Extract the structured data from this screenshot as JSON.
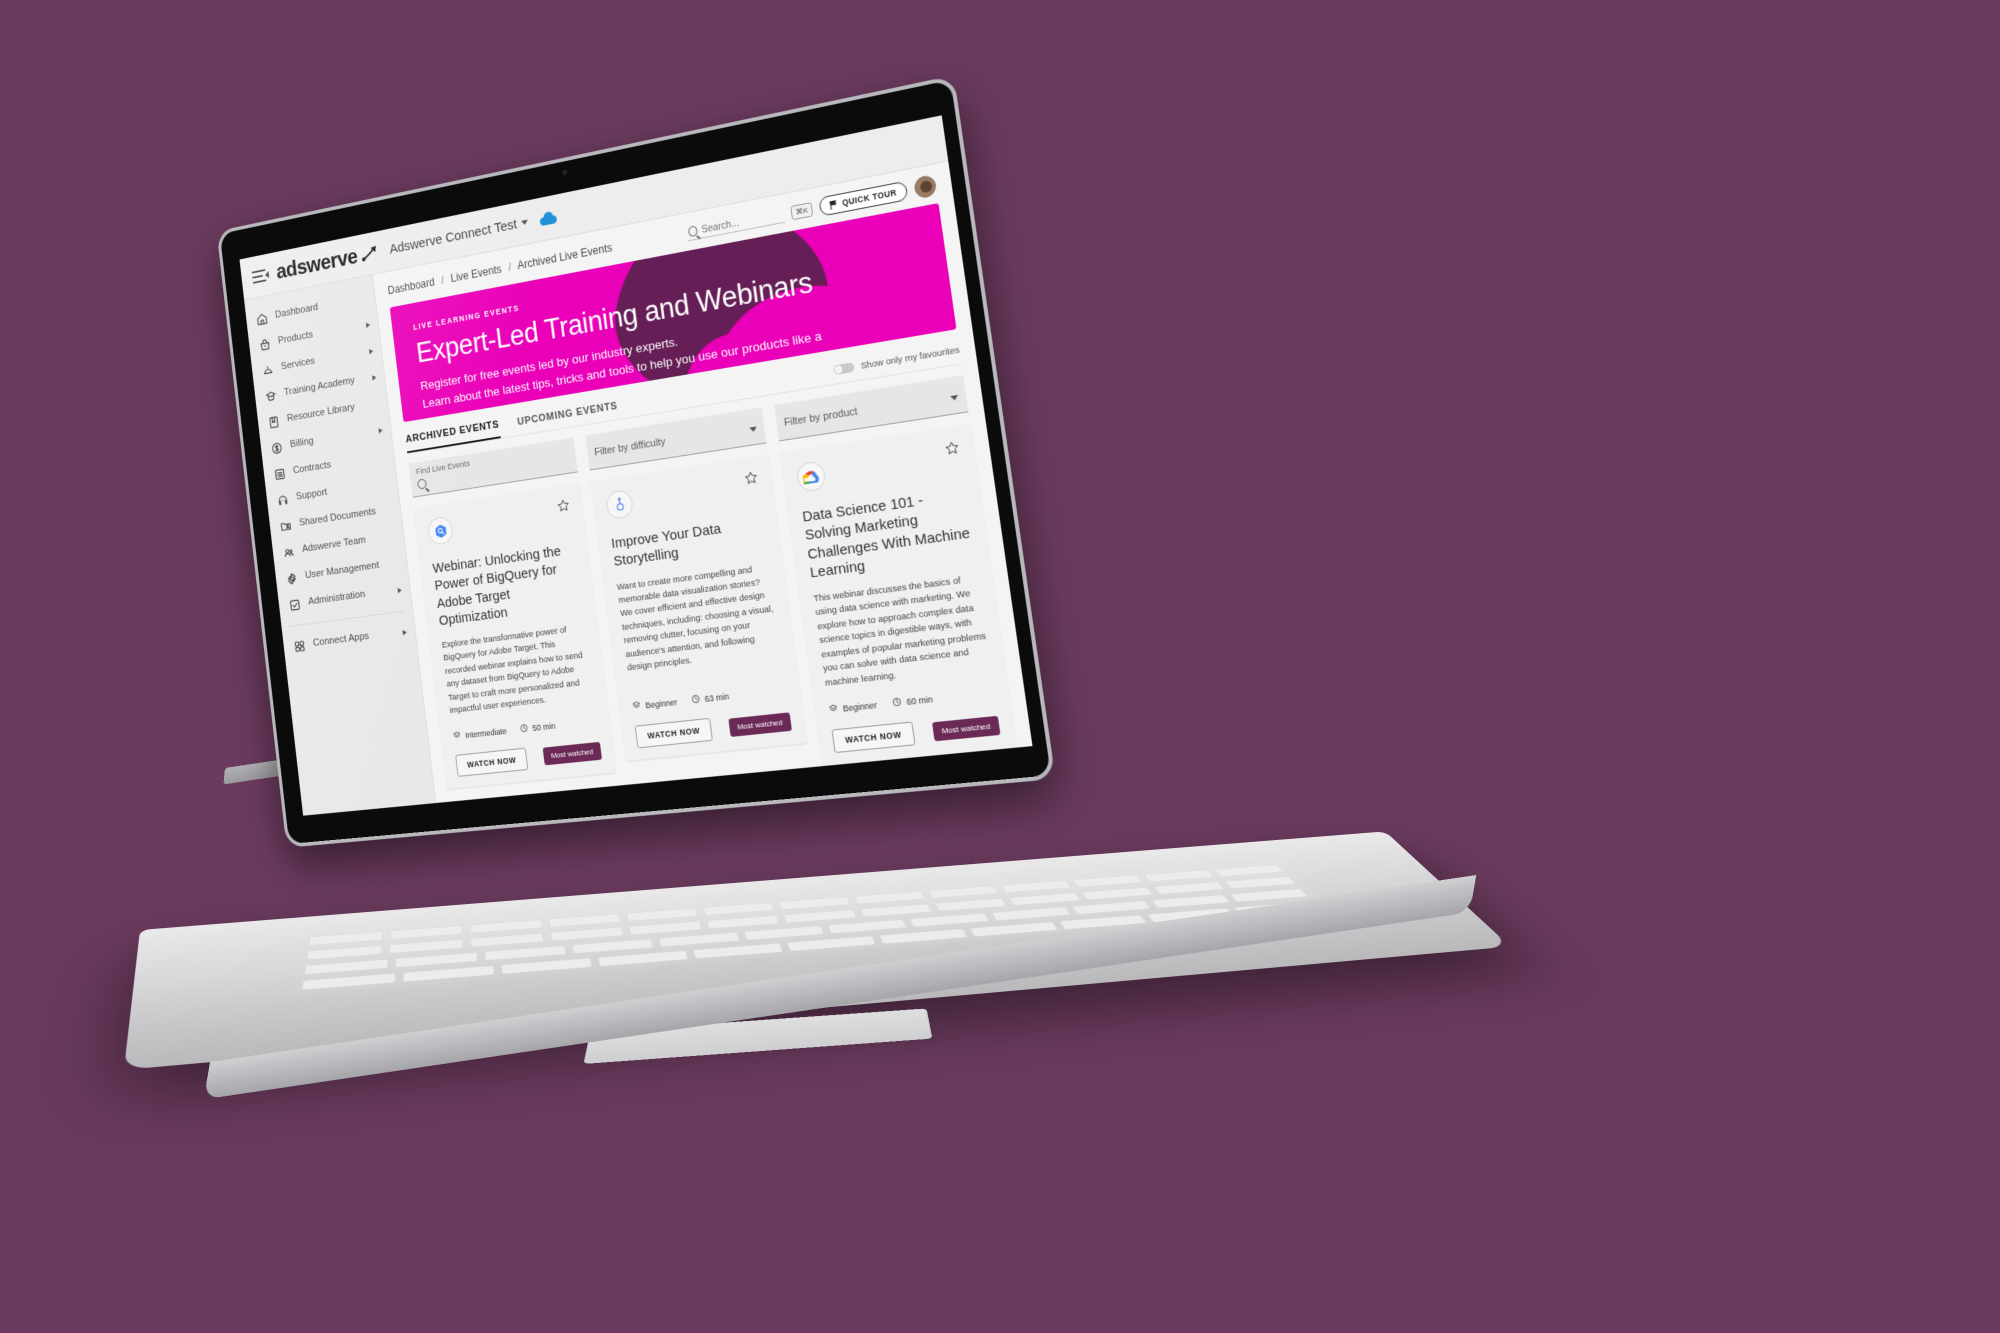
{
  "topbar": {
    "menu_icon": "hamburger-collapse-icon",
    "brand": "adswerve",
    "brand_mark_icon": "adswerve-swoosh-icon",
    "account": "Adswerve Connect Test",
    "account_caret_icon": "chevron-down-icon",
    "cloud_icon": "cloud-icon"
  },
  "sidebar": {
    "items": [
      {
        "label": "Dashboard",
        "icon": "home-icon",
        "expandable": false
      },
      {
        "label": "Products",
        "icon": "basket-icon",
        "expandable": true
      },
      {
        "label": "Services",
        "icon": "service-bell-icon",
        "expandable": true
      },
      {
        "label": "Training Academy",
        "icon": "graduation-cap-icon",
        "expandable": true
      },
      {
        "label": "Resource Library",
        "icon": "book-icon",
        "expandable": false
      },
      {
        "label": "Billing",
        "icon": "dollar-coin-icon",
        "expandable": true
      },
      {
        "label": "Contracts",
        "icon": "list-document-icon",
        "expandable": false
      },
      {
        "label": "Support",
        "icon": "headset-icon",
        "expandable": false
      },
      {
        "label": "Shared Documents",
        "icon": "shared-folder-icon",
        "expandable": false
      },
      {
        "label": "Adswerve Team",
        "icon": "people-icon",
        "expandable": false
      },
      {
        "label": "User Management",
        "icon": "gear-icon",
        "expandable": false
      },
      {
        "label": "Administration",
        "icon": "admin-check-icon",
        "expandable": true
      }
    ],
    "footer_items": [
      {
        "label": "Connect Apps",
        "icon": "grid-apps-icon",
        "expandable": true
      }
    ]
  },
  "breadcrumb": {
    "items": [
      "Dashboard",
      "Live Events",
      "Archived Live Events"
    ],
    "separator": "/"
  },
  "toolbar": {
    "search_placeholder": "Search...",
    "search_value": "",
    "search_icon": "search-icon",
    "shortcut_key": "⌘K",
    "quick_tour_label": "QUICK TOUR",
    "quick_tour_icon": "flag-icon",
    "avatar_name": "user-avatar"
  },
  "hero": {
    "eyebrow": "LIVE LEARNING EVENTS",
    "title": "Expert-Led Training and Webinars",
    "line1": "Register for free events led by our industry experts.",
    "line2": "Learn about the latest tips, tricks and tools to help you use our products like a pro.",
    "bg_color": "#ea00b8",
    "blob_color": "#5e2150"
  },
  "tabs": [
    {
      "label": "ARCHIVED EVENTS",
      "active": true
    },
    {
      "label": "UPCOMING EVENTS",
      "active": false
    }
  ],
  "favourites_toggle": {
    "label": "Show only my favourites",
    "on": false
  },
  "filters": [
    {
      "name": "find-live-events",
      "label": "Find Live Events",
      "value": "",
      "type": "search"
    },
    {
      "name": "filter-by-difficulty",
      "label": "",
      "value": "Filter by difficulty",
      "type": "select"
    },
    {
      "name": "filter-by-product",
      "label": "",
      "value": "Filter by product",
      "type": "select"
    }
  ],
  "cards": [
    {
      "logo_icon": "bigquery-icon",
      "logo_color": "#4285f4",
      "favourite_icon": "star-outline-icon",
      "title": "Webinar: Unlocking the Power of BigQuery for Adobe Target Optimization",
      "description": "Explore the transformative power of BigQuery for Adobe Target. This recorded webinar explains how to send any dataset from BigQuery to Adobe Target to craft more personalized and impactful user experiences.",
      "difficulty": "Intermediate",
      "difficulty_icon": "layers-icon",
      "duration": "50 min",
      "duration_icon": "clock-icon",
      "button_label": "WATCH NOW",
      "badge": "Most watched"
    },
    {
      "logo_icon": "data-storytelling-icon",
      "logo_color": "#5b8def",
      "favourite_icon": "star-outline-icon",
      "title": "Improve Your Data Storytelling",
      "description": "Want to create more compelling and memorable data visualization stories? We cover efficient and effective design techniques, including: choosing a visual, removing clutter, focusing on your audience's attention, and following design principles.",
      "difficulty": "Beginner",
      "difficulty_icon": "layers-icon",
      "duration": "63 min",
      "duration_icon": "clock-icon",
      "button_label": "WATCH NOW",
      "badge": "Most watched"
    },
    {
      "logo_icon": "google-cloud-icon",
      "logo_color": "#fbbc04",
      "favourite_icon": "star-outline-icon",
      "title": "Data Science 101 - Solving Marketing Challenges With Machine Learning",
      "description": "This webinar discusses the basics of using data science with marketing. We explore how to approach complex data science topics in digestible ways, with examples of popular marketing problems you can solve with data science and machine learning.",
      "difficulty": "Beginner",
      "difficulty_icon": "layers-icon",
      "duration": "60 min",
      "duration_icon": "clock-icon",
      "button_label": "WATCH NOW",
      "badge": "Most watched"
    }
  ],
  "colors": {
    "background": "#6b3a5e",
    "accent_pink": "#ea00b8",
    "badge_plum": "#6b2a55",
    "sidebar": "#e8e8e8"
  }
}
